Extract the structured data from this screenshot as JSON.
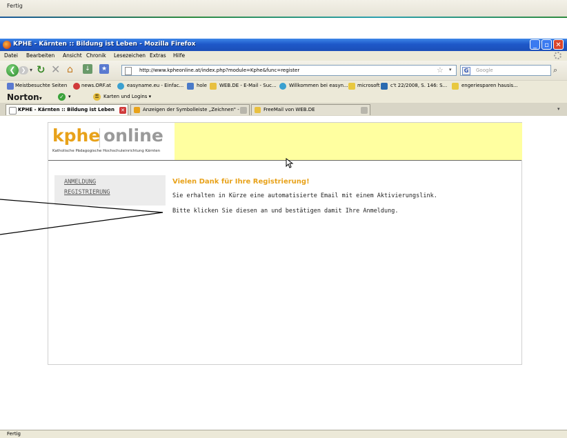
{
  "status_top": "Fertig",
  "status_bottom": "Fertig",
  "window": {
    "title": "KPHE - Kärnten :: Bildung ist Leben - Mozilla Firefox"
  },
  "menu": [
    "Datei",
    "Bearbeiten",
    "Ansicht",
    "Chronik",
    "Lesezeichen",
    "Extras",
    "Hilfe"
  ],
  "nav": {
    "url": "http://www.kpheonline.at/index.php?module=Kphe&func=register",
    "search_placeholder": "Google"
  },
  "bookmarks": [
    "Meistbesuchte Seiten",
    "news.ORF.at",
    "easyname.eu - Einfac...",
    "hole",
    "WEB.DE - E-Mail - Suc...",
    "Willkommen bei easyn...",
    "microsoft",
    "c't 22/2008, S. 146: S...",
    "engeriesparen hausis..."
  ],
  "norton": {
    "logo": "Norton",
    "dd1": "▾",
    "dd2": "▾",
    "key_label": "Karten und Logins ▾"
  },
  "tabs": [
    {
      "label": "KPHE - Kärnten :: Bildung ist Leben"
    },
    {
      "label": "Anzeigen der Symbolleiste „Zeichnen\" - ..."
    },
    {
      "label": "FreeMail von WEB.DE"
    }
  ],
  "page": {
    "logo_kphe": "kphe",
    "logo_online": "online",
    "logo_subtitle": "Katholische Pädagogische Hochschuleinrichtung Kärnten",
    "sidebar": [
      "ANMELDUNG",
      "REGISTRIERUNG"
    ],
    "heading": "Vielen Dank für Ihre Registrierung!",
    "line1": "Sie erhalten in Kürze eine automatisierte Email mit einem Aktivierungslink.",
    "line2": "Bitte klicken Sie diesen an und bestätigen damit Ihre Anmeldung."
  },
  "colors": {
    "accent": "#e8a21a",
    "banner": "#ffffa0",
    "titlebar": "#1e58c9"
  }
}
